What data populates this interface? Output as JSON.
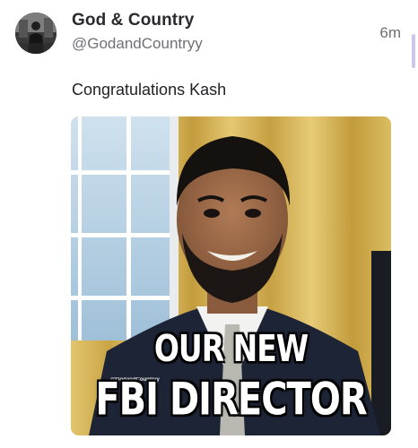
{
  "post": {
    "display_name": "God & Country",
    "handle": "@GodandCountryy",
    "timestamp": "6m",
    "text": "Congratulations Kash"
  },
  "media": {
    "caption_line1": "OUR NEW",
    "caption_line2": "FBI DIRECTOR",
    "watermark": "@GodandCountryy"
  },
  "colors": {
    "name": "#2a2a2e",
    "secondary_text": "#6f6f78",
    "scroll_indicator": "#c9c7ee"
  }
}
